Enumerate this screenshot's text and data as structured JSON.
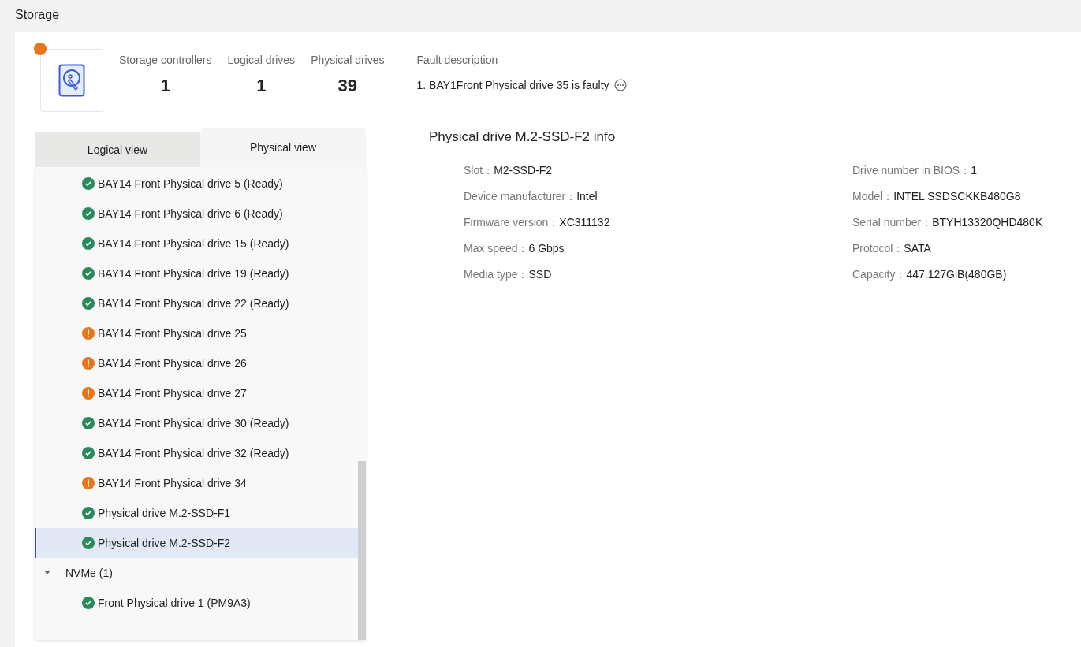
{
  "page_title": "Storage",
  "summary": {
    "alert": true,
    "stats": [
      {
        "label": "Storage controllers",
        "value": "1"
      },
      {
        "label": "Logical drives",
        "value": "1"
      },
      {
        "label": "Physical drives",
        "value": "39"
      }
    ],
    "fault_title": "Fault description",
    "faults": [
      "1. BAY1Front Physical drive 35 is faulty"
    ]
  },
  "tabs": [
    {
      "label": "Logical view",
      "selected": false
    },
    {
      "label": "Physical view",
      "selected": true
    }
  ],
  "tree": [
    {
      "kind": "drive",
      "label": "BAY14 Front Physical drive 5 (Ready)",
      "faulty": false,
      "selected": false
    },
    {
      "kind": "drive",
      "label": "BAY14 Front Physical drive 6 (Ready)",
      "faulty": false,
      "selected": false
    },
    {
      "kind": "drive",
      "label": "BAY14 Front Physical drive 15 (Ready)",
      "faulty": false,
      "selected": false
    },
    {
      "kind": "drive",
      "label": "BAY14 Front Physical drive 19 (Ready)",
      "faulty": false,
      "selected": false
    },
    {
      "kind": "drive",
      "label": "BAY14 Front Physical drive 22 (Ready)",
      "faulty": false,
      "selected": false
    },
    {
      "kind": "drive",
      "label": "BAY14 Front Physical drive 25",
      "faulty": true,
      "selected": false
    },
    {
      "kind": "drive",
      "label": "BAY14 Front Physical drive 26",
      "faulty": true,
      "selected": false
    },
    {
      "kind": "drive",
      "label": "BAY14 Front Physical drive 27",
      "faulty": true,
      "selected": false
    },
    {
      "kind": "drive",
      "label": "BAY14 Front Physical drive 30 (Ready)",
      "faulty": false,
      "selected": false
    },
    {
      "kind": "drive",
      "label": "BAY14 Front Physical drive 32 (Ready)",
      "faulty": false,
      "selected": false
    },
    {
      "kind": "drive",
      "label": "BAY14 Front Physical drive 34",
      "faulty": true,
      "selected": false
    },
    {
      "kind": "drive",
      "label": "Physical drive M.2-SSD-F1",
      "faulty": false,
      "selected": false
    },
    {
      "kind": "drive",
      "label": "Physical drive M.2-SSD-F2",
      "faulty": false,
      "selected": true
    },
    {
      "kind": "group",
      "label": "NVMe (1)",
      "expanded": true,
      "selected": false,
      "children": [
        {
          "kind": "drive",
          "label": "Front Physical drive 1 (PM9A3)",
          "faulty": false,
          "selected": false
        }
      ]
    }
  ],
  "info": {
    "title": "Physical drive M.2-SSD-F2 info",
    "left": [
      {
        "label": "Slot：",
        "value": "M2-SSD-F2"
      },
      {
        "label": "Device manufacturer：",
        "value": "Intel"
      },
      {
        "label": "Firmware version：",
        "value": "XC311132"
      },
      {
        "label": "Max speed：",
        "value": "6 Gbps"
      },
      {
        "label": "Media type：",
        "value": "SSD"
      }
    ],
    "right": [
      {
        "label": "Drive number in BIOS：",
        "value": "1"
      },
      {
        "label": "Model：",
        "value": "INTEL SSDSCKKB480G8"
      },
      {
        "label": "Serial number：",
        "value": "BTYH13320QHD480K"
      },
      {
        "label": "Protocol：",
        "value": "SATA"
      },
      {
        "label": "Capacity：",
        "value": "447.127GiB(480GB)"
      }
    ]
  }
}
